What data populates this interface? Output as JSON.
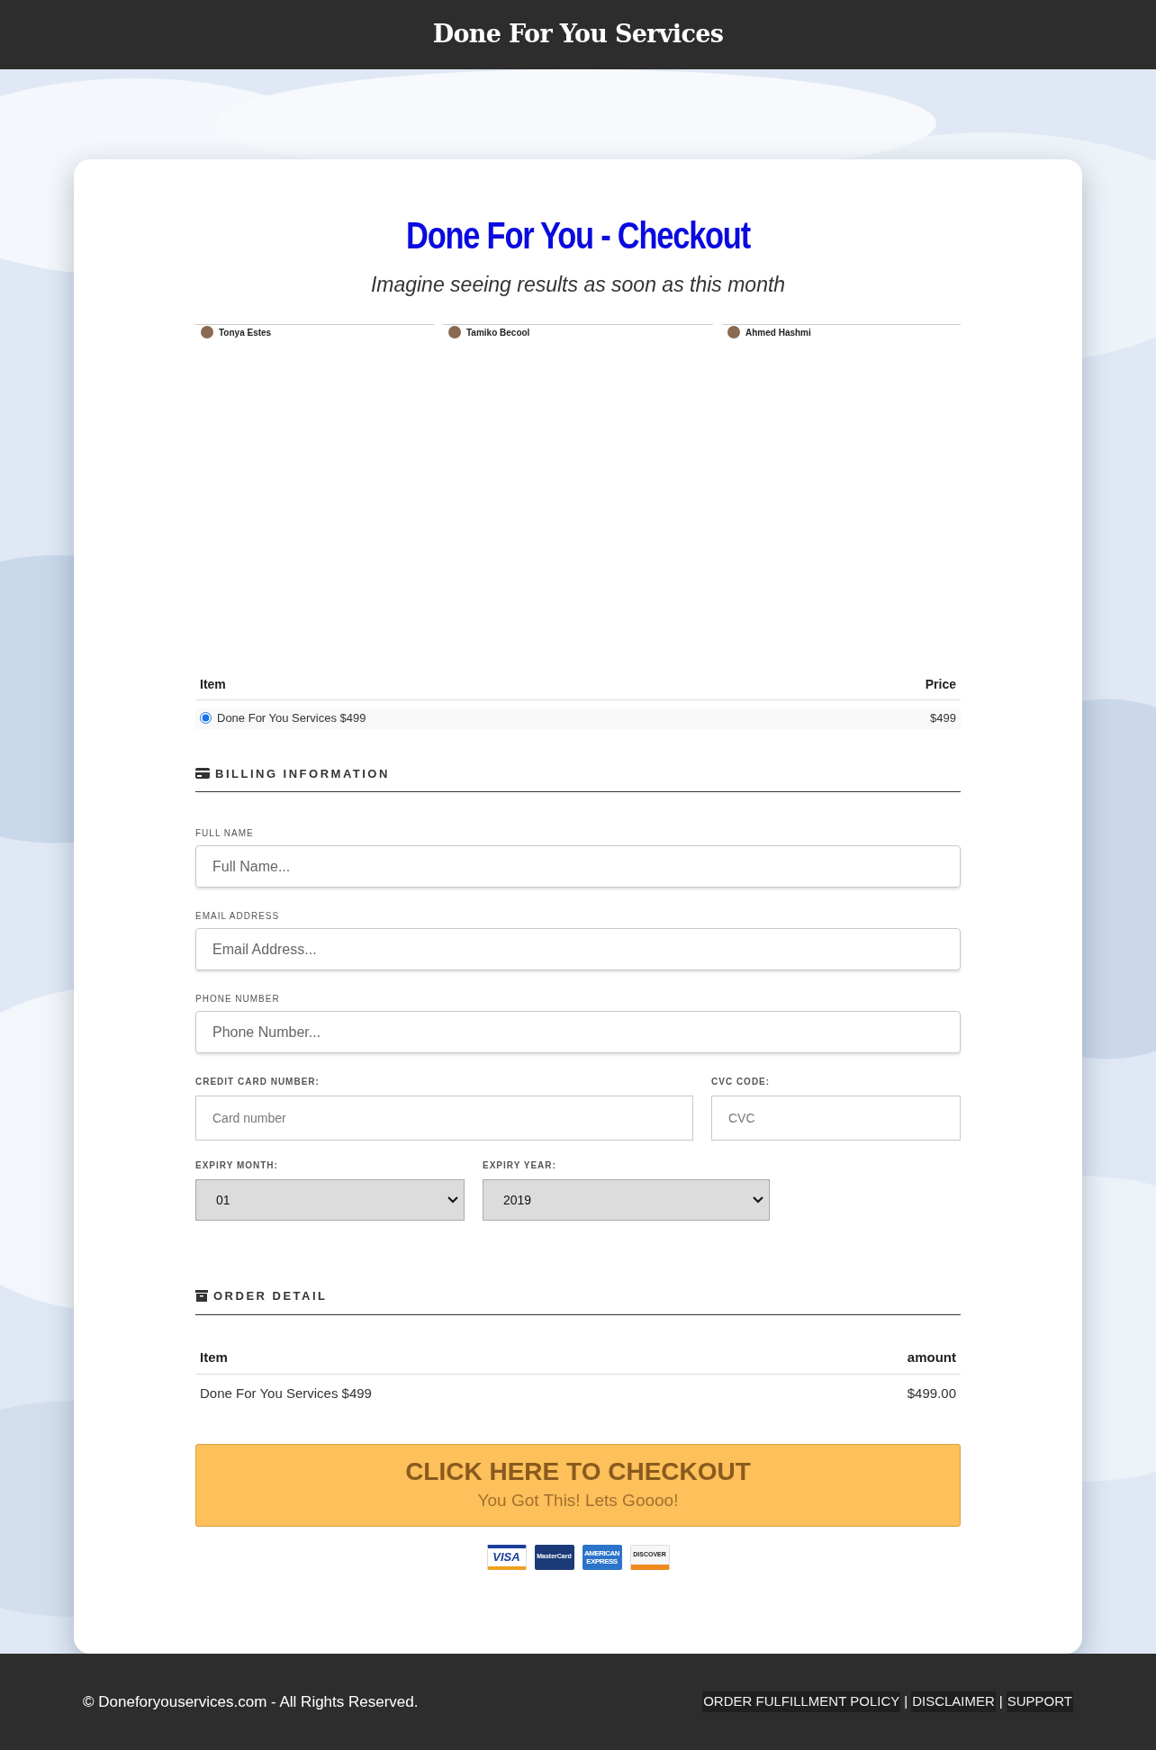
{
  "header": {
    "title": "Done For You Services"
  },
  "checkout": {
    "title": "Done For You - Checkout",
    "subtitle": "Imagine seeing results as soon as this month",
    "testimonials": [
      {
        "name": "Tonya Estes"
      },
      {
        "name": "Tamiko Becool"
      },
      {
        "name": "Ahmed Hashmi"
      }
    ],
    "products": {
      "columns": [
        "Item",
        "Price"
      ],
      "rows": [
        {
          "label": "Done For You Services $499",
          "price": "$499",
          "selected": true
        }
      ]
    },
    "billing": {
      "heading": "BILLING INFORMATION",
      "fields": [
        {
          "label": "FULL NAME",
          "placeholder": "Full Name..."
        },
        {
          "label": "EMAIL ADDRESS",
          "placeholder": "Email Address..."
        },
        {
          "label": "PHONE NUMBER",
          "placeholder": "Phone Number..."
        }
      ],
      "card_number": {
        "label": "CREDIT CARD NUMBER:",
        "placeholder": "Card number"
      },
      "cvc": {
        "label": "CVC CODE:",
        "placeholder": "CVC"
      },
      "expiry_month": {
        "label": "EXPIRY MONTH:",
        "value": "01"
      },
      "expiry_year": {
        "label": "EXPIRY YEAR:",
        "value": "2019"
      }
    },
    "order": {
      "heading": "ORDER DETAIL",
      "columns": [
        "Item",
        "amount"
      ],
      "rows": [
        {
          "item": "Done For You Services $499",
          "amount": "$499.00"
        }
      ]
    },
    "button": {
      "label": "CLICK HERE TO CHECKOUT",
      "sublabel": "You Got This! Lets Goooo!"
    },
    "cards": [
      {
        "kind": "visa",
        "text": "VISA"
      },
      {
        "kind": "mastercard",
        "text": "MasterCard"
      },
      {
        "kind": "amex",
        "text": "AMERICAN EXPRESS"
      },
      {
        "kind": "discover",
        "text": "DISCOVER"
      }
    ]
  },
  "footer": {
    "copyright": "© Doneforyouservices.com - All Rights Reserved.",
    "links": [
      "ORDER FULFILLMENT POLICY",
      "DISCLAIMER",
      "SUPPORT"
    ],
    "separator": "|"
  }
}
